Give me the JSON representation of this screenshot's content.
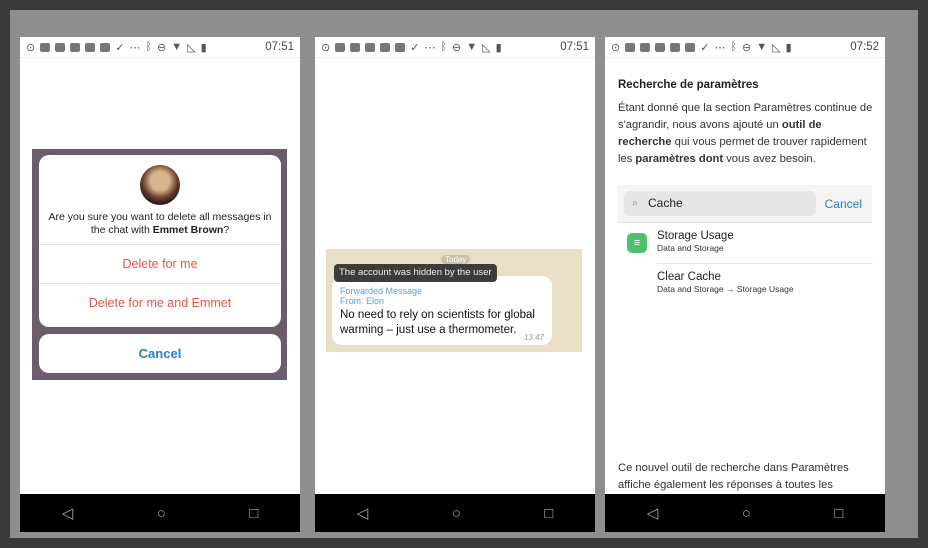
{
  "status": {
    "time1": "07:51",
    "time2": "07:51",
    "time3": "07:52"
  },
  "nav": {
    "back": "◁",
    "home": "○",
    "recent": "□"
  },
  "panel1": {
    "message_prefix": "Are you sure you want to delete all messages in the chat with ",
    "contact": "Emmet Brown",
    "message_suffix": "?",
    "delete_me": "Delete for me",
    "delete_both": "Delete for me and Emmet",
    "cancel": "Cancel",
    "colors": {
      "destructive": "#e2574a",
      "accent": "#2a7ec4"
    }
  },
  "panel2": {
    "date_chip": "Today",
    "tooltip": "The account was hidden by the user",
    "forwarded": "Forwarded Message",
    "from": "From: Elon",
    "text": "No need to rely on scientists for global warming – just use a thermometer.",
    "time": "13:47"
  },
  "panel3": {
    "title": "Recherche de paramètres",
    "intro_1": "Étant donné que la section Paramètres continue de s'agrandir, nous avons ajouté un ",
    "intro_b1": "outil de recherche",
    "intro_2": " qui vous permet de trouver rapidement les ",
    "intro_b2": "paramètres dont",
    "intro_3": " vous avez besoin.",
    "search_value": "Cache",
    "cancel": "Cancel",
    "results": [
      {
        "title": "Storage Usage",
        "sub": "Data and Storage"
      },
      {
        "title": "Clear Cache",
        "sub": "Data and Storage → Storage Usage"
      }
    ],
    "footer": "Ce nouvel outil de recherche dans Paramètres affiche également les réponses à toutes les"
  }
}
